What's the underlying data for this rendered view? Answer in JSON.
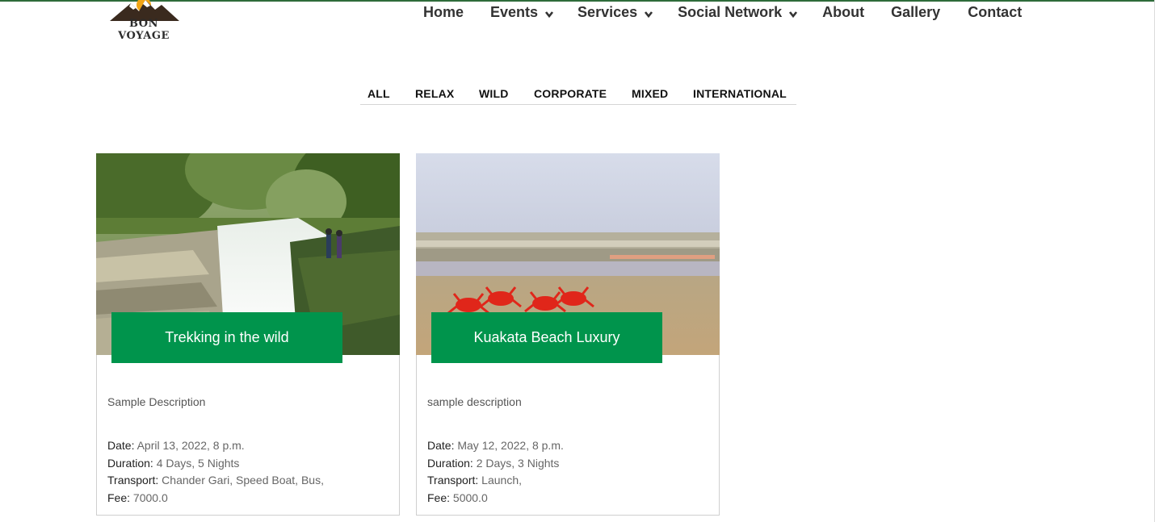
{
  "brand": {
    "logo_text": "BON VOYAGE",
    "accent": "#00944c",
    "topline": "#2e6b3a"
  },
  "nav": {
    "items": [
      {
        "label": "Home",
        "has_dropdown": false
      },
      {
        "label": "Events",
        "has_dropdown": true
      },
      {
        "label": "Services",
        "has_dropdown": true
      },
      {
        "label": "Social Network",
        "has_dropdown": true
      },
      {
        "label": "About",
        "has_dropdown": false
      },
      {
        "label": "Gallery",
        "has_dropdown": false
      },
      {
        "label": "Contact",
        "has_dropdown": false
      }
    ],
    "dropdown_icon": "chevron-down-icon"
  },
  "filters": [
    "ALL",
    "RELAX",
    "WILD",
    "CORPORATE",
    "MIXED",
    "INTERNATIONAL"
  ],
  "cards": [
    {
      "title": "Trekking in the wild",
      "image": "waterfall-photo",
      "description": "Sample Description",
      "meta": [
        {
          "label": "Date:",
          "value": "April 13, 2022, 8 p.m."
        },
        {
          "label": "Duration:",
          "value": "4 Days, 5 Nights"
        },
        {
          "label": "Transport:",
          "value": "Chander Gari, Speed Boat, Bus,"
        },
        {
          "label": "Fee:",
          "value": "7000.0"
        }
      ]
    },
    {
      "title": "Kuakata Beach Luxury",
      "image": "beach-crabs-photo",
      "description": "sample description",
      "meta": [
        {
          "label": "Date:",
          "value": "May 12, 2022, 8 p.m."
        },
        {
          "label": "Duration:",
          "value": "2 Days, 3 Nights"
        },
        {
          "label": "Transport:",
          "value": "Launch,"
        },
        {
          "label": "Fee:",
          "value": "5000.0"
        }
      ]
    }
  ]
}
